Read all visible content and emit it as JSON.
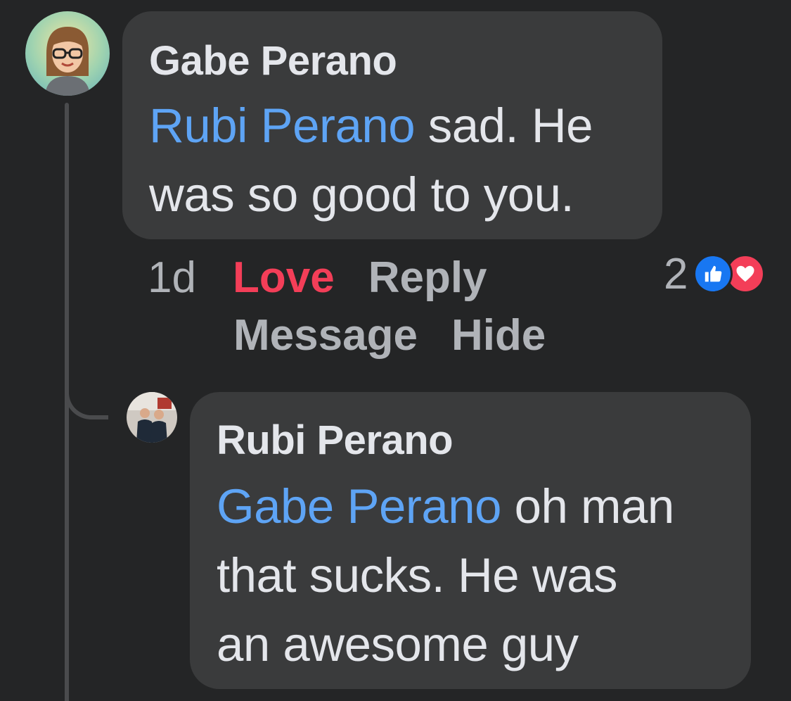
{
  "thread": {
    "comment": {
      "author": "Gabe Perano",
      "mention": "Rubi Perano",
      "line1_rest": " sad. He",
      "line2": "was so good to you.",
      "timestamp": "1d",
      "actions": {
        "love": "Love",
        "reply": "Reply",
        "message": "Message",
        "hide": "Hide"
      },
      "reaction_count": "2",
      "reaction_icons": [
        "like-icon",
        "heart-icon"
      ],
      "colors": {
        "mention": "#5ea4f5",
        "love_action": "#f33e58",
        "like": "#1877f2",
        "heart": "#f33e58"
      }
    },
    "reply": {
      "author": "Rubi Perano",
      "mention": "Gabe Perano",
      "line1_rest": " oh man",
      "line2": "that sucks. He was",
      "line3": "an awesome guy"
    }
  }
}
